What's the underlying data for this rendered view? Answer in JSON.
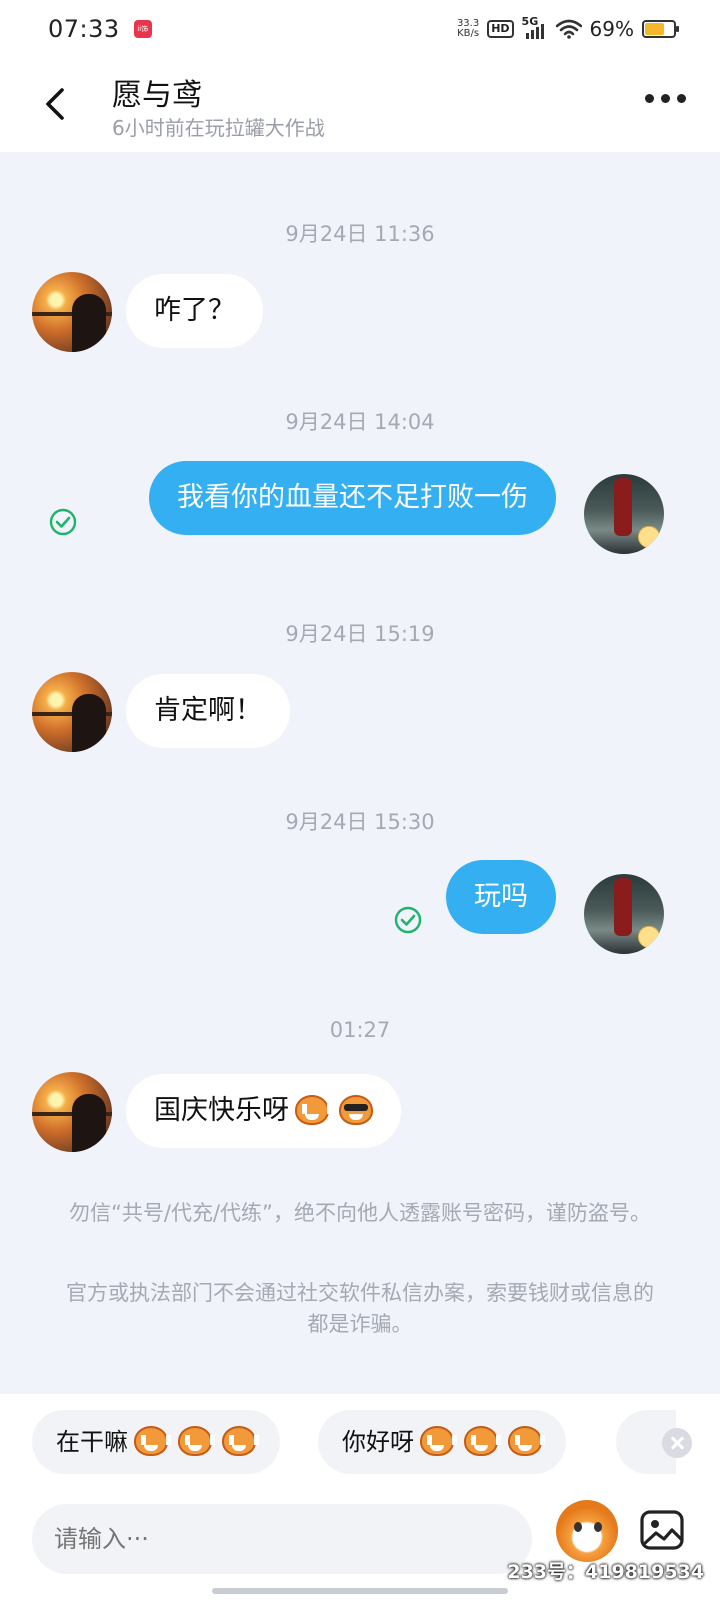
{
  "status_bar": {
    "time": "07:33",
    "app_badge": "ii饰",
    "net_speed_value": "33.3",
    "net_speed_unit": "KB/s",
    "hd": "HD",
    "network": "5G",
    "battery_percent": "69%",
    "battery_level": 0.69
  },
  "header": {
    "contact_name": "愿与鸢",
    "contact_status": "6小时前在玩拉罐大作战"
  },
  "messages": [
    {
      "timestamp": "9月24日 11:36",
      "side": "in",
      "text": "咋了？"
    },
    {
      "timestamp": "9月24日 14:04",
      "side": "out",
      "text": "我看你的血量还不足打败一伤",
      "read": true
    },
    {
      "timestamp": "9月24日 15:19",
      "side": "in",
      "text": "肯定啊！"
    },
    {
      "timestamp": "9月24日 15:30",
      "side": "out",
      "text": "玩吗",
      "read": true
    },
    {
      "timestamp": "01:27",
      "side": "in",
      "text": "国庆快乐呀",
      "emojis": [
        "monkey-emoji",
        "cool-monkey-emoji"
      ]
    }
  ],
  "notices": [
    "勿信“共号/代充/代练”，绝不向他人透露账号密码，谨防盗号。",
    "官方或执法部门不会通过社交软件私信办案，索要钱财或信息的都是诈骗。"
  ],
  "quick_replies": [
    {
      "text": "在干嘛",
      "emojis": [
        "grin-monkey-emoji",
        "grin-monkey-emoji",
        "grin-monkey-emoji"
      ]
    },
    {
      "text": "你好呀",
      "emojis": [
        "monkey-emoji",
        "monkey-emoji",
        "monkey-emoji"
      ]
    }
  ],
  "input": {
    "placeholder": "请输入···"
  },
  "watermark": "233号：419819534",
  "colors": {
    "accent": "#34b0f2",
    "read_check": "#1fb46a",
    "background": "#f0f3f9"
  }
}
